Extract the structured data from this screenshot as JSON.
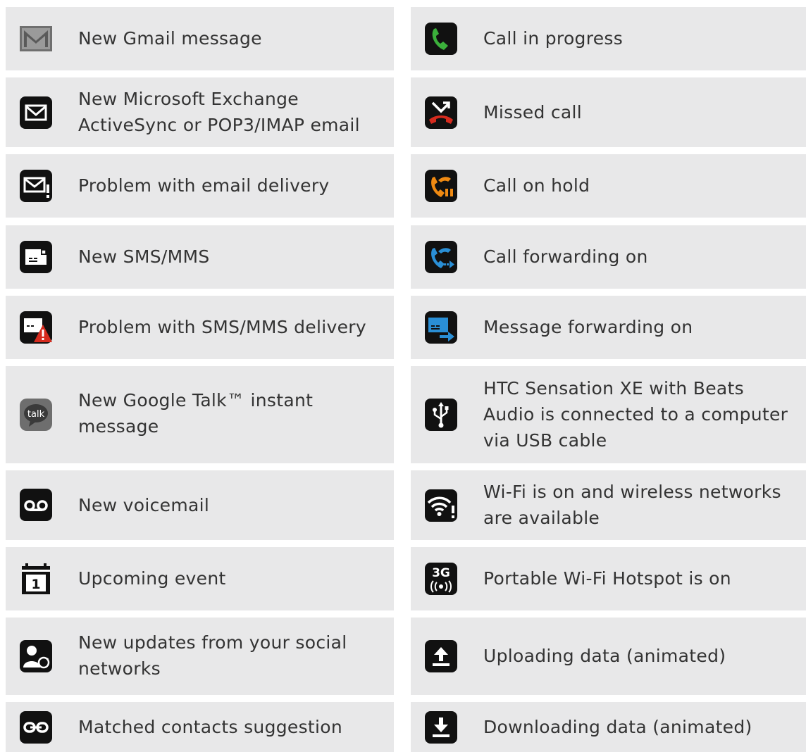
{
  "left_column": [
    {
      "icon": "gmail-envelope-icon",
      "label": "New Gmail message"
    },
    {
      "icon": "email-envelope-icon",
      "label": "New Microsoft Exchange ActiveSync or POP3/IMAP email"
    },
    {
      "icon": "email-error-icon",
      "label": "Problem with email delivery"
    },
    {
      "icon": "sms-icon",
      "label": "New SMS/MMS"
    },
    {
      "icon": "sms-warning-icon",
      "label": "Problem with SMS/MMS delivery"
    },
    {
      "icon": "google-talk-icon",
      "label": "New Google Talk™ instant message"
    },
    {
      "icon": "voicemail-icon",
      "label": "New voicemail"
    },
    {
      "icon": "calendar-icon",
      "label": "Upcoming event"
    },
    {
      "icon": "social-update-icon",
      "label": "New updates from your social networks"
    },
    {
      "icon": "link-icon",
      "label": "Matched contacts suggestion"
    }
  ],
  "right_column": [
    {
      "icon": "call-in-progress-icon",
      "label": "Call in progress"
    },
    {
      "icon": "missed-call-icon",
      "label": "Missed call"
    },
    {
      "icon": "call-hold-icon",
      "label": "Call on hold"
    },
    {
      "icon": "call-forwarding-icon",
      "label": "Call forwarding on"
    },
    {
      "icon": "message-forwarding-icon",
      "label": "Message forwarding on"
    },
    {
      "icon": "usb-icon",
      "label": "HTC Sensation XE with Beats Audio is connected to a computer via USB cable"
    },
    {
      "icon": "wifi-available-icon",
      "label": "Wi-Fi is on and wireless networks are available"
    },
    {
      "icon": "hotspot-3g-icon",
      "label": "Portable Wi-Fi Hotspot is on"
    },
    {
      "icon": "upload-icon",
      "label": "Uploading data (animated)"
    },
    {
      "icon": "download-icon",
      "label": "Downloading data (animated)"
    }
  ],
  "colors": {
    "row_background": "#e8e8e9",
    "text": "#333333",
    "icon_black": "#111111",
    "call_green": "#3bb03b",
    "missed_red": "#d62b1e",
    "hold_orange": "#f08a12",
    "forward_blue": "#2a8fd6"
  }
}
